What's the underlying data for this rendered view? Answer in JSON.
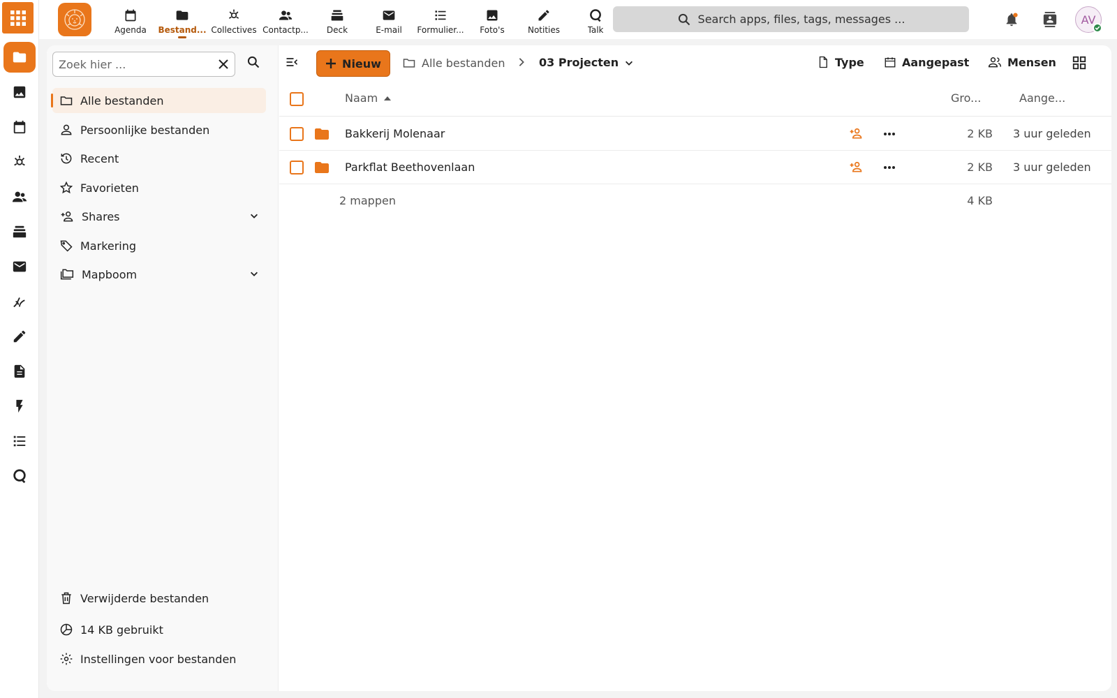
{
  "topnav": {
    "apps": [
      {
        "label": "Agenda",
        "icon": "calendar-icon"
      },
      {
        "label": "Bestand...",
        "icon": "folder-icon",
        "active": true
      },
      {
        "label": "Collectives",
        "icon": "collectives-icon"
      },
      {
        "label": "Contactp...",
        "icon": "contacts-icon"
      },
      {
        "label": "Deck",
        "icon": "deck-icon"
      },
      {
        "label": "E-mail",
        "icon": "mail-icon"
      },
      {
        "label": "Formulier...",
        "icon": "forms-icon"
      },
      {
        "label": "Foto's",
        "icon": "photos-icon"
      },
      {
        "label": "Notities",
        "icon": "pencil-icon"
      },
      {
        "label": "Talk",
        "icon": "talk-icon"
      }
    ],
    "search_placeholder": "Search apps, files, tags, messages ...",
    "avatar_initials": "AV"
  },
  "sidebar": {
    "filter_placeholder": "Zoek hier ...",
    "items": [
      {
        "label": "Alle bestanden",
        "icon": "folder-icon",
        "active": true
      },
      {
        "label": "Persoonlijke bestanden",
        "icon": "person-icon"
      },
      {
        "label": "Recent",
        "icon": "history-icon"
      },
      {
        "label": "Favorieten",
        "icon": "star-icon"
      },
      {
        "label": "Shares",
        "icon": "share-icon",
        "expandable": true
      },
      {
        "label": "Markering",
        "icon": "tag-icon"
      },
      {
        "label": "Mapboom",
        "icon": "folder-tree-icon",
        "expandable": true
      }
    ],
    "deleted_label": "Verwijderde bestanden",
    "quota_label": "14 KB gebruikt",
    "settings_label": "Instellingen voor bestanden"
  },
  "toolbar": {
    "new_label": "Nieuw",
    "breadcrumb_root": "Alle bestanden",
    "breadcrumb_current": "03 Projecten",
    "filter_type": "Type",
    "filter_modified": "Aangepast",
    "filter_people": "Mensen"
  },
  "table": {
    "col_name": "Naam",
    "col_size": "Gro...",
    "col_modified": "Aange...",
    "rows": [
      {
        "name": "Bakkerij Molenaar",
        "size": "2 KB",
        "modified": "3 uur geleden"
      },
      {
        "name": "Parkflat Beethovenlaan",
        "size": "2 KB",
        "modified": "3 uur geleden"
      }
    ],
    "summary_label": "2 mappen",
    "summary_size": "4 KB"
  },
  "colors": {
    "accent": "#e9761b",
    "accent_dark": "#b55a0c"
  }
}
